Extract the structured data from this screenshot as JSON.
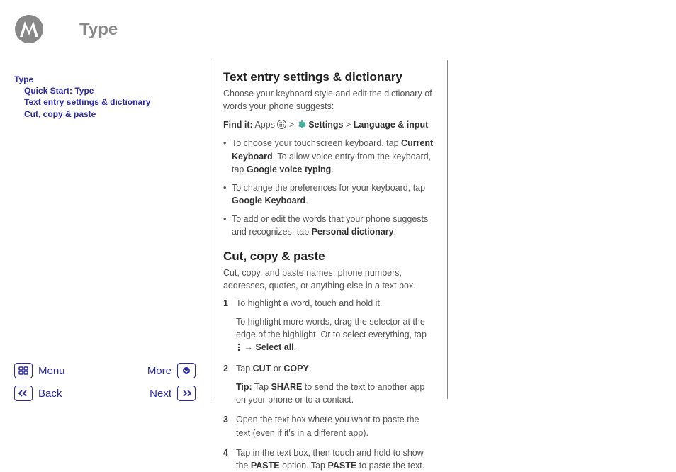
{
  "header": {
    "title": "Type"
  },
  "toc": {
    "root": "Type",
    "items": [
      "Quick Start: Type",
      "Text entry settings & dictionary",
      "Cut, copy & paste"
    ]
  },
  "section1": {
    "heading": "Text entry settings & dictionary",
    "intro": "Choose your keyboard style and edit the dictionary of words your phone suggests:",
    "findit_label": "Find it:",
    "findit_apps": "Apps",
    "findit_gt1": ">",
    "findit_settings": "Settings",
    "findit_gt2": ">",
    "findit_lang": "Language & input",
    "bullet1_a": "To choose your touchscreen keyboard, tap ",
    "bullet1_b": "Current Keyboard",
    "bullet1_c": ". To allow voice entry from the keyboard, tap ",
    "bullet1_d": "Google voice typing",
    "bullet1_e": ".",
    "bullet2_a": "To change the preferences for your keyboard, tap ",
    "bullet2_b": "Google Keyboard",
    "bullet2_c": ".",
    "bullet3_a": "To add or edit the words that your phone suggests and recognizes, tap ",
    "bullet3_b": "Personal dictionary",
    "bullet3_c": "."
  },
  "section2": {
    "heading": "Cut, copy & paste",
    "intro": "Cut, copy, and paste names, phone numbers, addresses, quotes, or anything else in a text box.",
    "step1_num": "1",
    "step1_a": "To highlight a word, touch and hold it.",
    "step1_sub_a": "To highlight more words, drag the selector at the edge of the highlight. Or to select everything, tap ",
    "step1_sub_arrow": " → ",
    "step1_sub_b": "Select all",
    "step1_sub_c": ".",
    "step2_num": "2",
    "step2_a": "Tap ",
    "step2_b": "CUT",
    "step2_c": " or ",
    "step2_d": "COPY",
    "step2_e": ".",
    "step2_tip_label": "Tip:",
    "step2_tip_a": " Tap ",
    "step2_tip_b": "SHARE",
    "step2_tip_c": " to send the text to another app on your phone or to a contact.",
    "step3_num": "3",
    "step3": "Open the text box where you want to paste the text (even if it's in a different app).",
    "step4_num": "4",
    "step4_a": "Tap in the text box, then touch and hold to show the ",
    "step4_b": "PASTE",
    "step4_c": " option. Tap ",
    "step4_d": "PASTE",
    "step4_e": " to paste the text."
  },
  "nav": {
    "menu": "Menu",
    "more": "More",
    "back": "Back",
    "next": "Next"
  }
}
